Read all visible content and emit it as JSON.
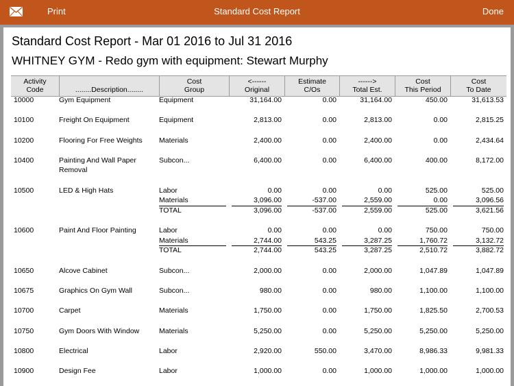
{
  "topbar": {
    "mail_icon": "mail-icon",
    "print_label": "Print",
    "title": "Standard Cost Report",
    "done_label": "Done",
    "bg_color": "#c0561b"
  },
  "report": {
    "title": "Standard Cost Report - Mar 01 2016 to Jul 31 2016",
    "subtitle": "WHITNEY GYM - Redo gym with equipment: Stewart Murphy"
  },
  "columns": [
    {
      "l1": "Activity",
      "l2": "Code"
    },
    {
      "l1": "",
      "l2": "........Description........"
    },
    {
      "l1": "Cost",
      "l2": "Group"
    },
    {
      "l1": "<------",
      "l2": "Original"
    },
    {
      "l1": "Estimate",
      "l2": "C/Os"
    },
    {
      "l1": "------>",
      "l2": "Total Est."
    },
    {
      "l1": "Cost",
      "l2": "This Period"
    },
    {
      "l1": "Cost",
      "l2": "To Date"
    }
  ],
  "rows": [
    {
      "code": "10000",
      "desc": "Gym Equipment",
      "lines": [
        {
          "group": "Equipment",
          "orig": "31,164.00",
          "cos": "0.00",
          "total": "31,164.00",
          "period": "450.00",
          "todate": "31,613.53"
        }
      ]
    },
    {
      "code": "10100",
      "desc": "Freight On Equipment",
      "lines": [
        {
          "group": "Equipment",
          "orig": "2,813.00",
          "cos": "0.00",
          "total": "2,813.00",
          "period": "0.00",
          "todate": "2,815.25"
        }
      ]
    },
    {
      "code": "10200",
      "desc": "Flooring For Free Weights",
      "lines": [
        {
          "group": "Materials",
          "orig": "2,400.00",
          "cos": "0.00",
          "total": "2,400.00",
          "period": "0.00",
          "todate": "2,434.64"
        }
      ]
    },
    {
      "code": "10400",
      "desc": "Painting And Wall Paper",
      "desc2": "Removal",
      "lines": [
        {
          "group": "Subcon...",
          "orig": "6,400.00",
          "cos": "0.00",
          "total": "6,400.00",
          "period": "400.00",
          "todate": "8,172.00"
        }
      ]
    },
    {
      "code": "10500",
      "desc": "LED & High Hats",
      "lines": [
        {
          "group": "Labor",
          "orig": "0.00",
          "cos": "0.00",
          "total": "0.00",
          "period": "525.00",
          "todate": "525.00"
        },
        {
          "group": "Materials",
          "orig": "3,096.00",
          "cos": "-537.00",
          "total": "2,559.00",
          "period": "0.00",
          "todate": "3,096.56"
        },
        {
          "group": "TOTAL",
          "orig": "3,096.00",
          "cos": "-537.00",
          "total": "2,559.00",
          "period": "525.00",
          "todate": "3,621.56",
          "is_total": true
        }
      ]
    },
    {
      "code": "10600",
      "desc": "Paint And Floor Painting",
      "lines": [
        {
          "group": "Labor",
          "orig": "0.00",
          "cos": "0.00",
          "total": "0.00",
          "period": "750.00",
          "todate": "750.00"
        },
        {
          "group": "Materials",
          "orig": "2,744.00",
          "cos": "543.25",
          "total": "3,287.25",
          "period": "1,760.72",
          "todate": "3,132.72"
        },
        {
          "group": "TOTAL",
          "orig": "2,744.00",
          "cos": "543.25",
          "total": "3,287.25",
          "period": "2,510.72",
          "todate": "3,882.72",
          "is_total": true
        }
      ]
    },
    {
      "code": "10650",
      "desc": "Alcove Cabinet",
      "lines": [
        {
          "group": "Subcon...",
          "orig": "2,000.00",
          "cos": "0.00",
          "total": "2,000.00",
          "period": "1,047.89",
          "todate": "1,047.89"
        }
      ]
    },
    {
      "code": "10675",
      "desc": "Graphics On Gym Wall",
      "lines": [
        {
          "group": "Subcon...",
          "orig": "980.00",
          "cos": "0.00",
          "total": "980.00",
          "period": "1,100.00",
          "todate": "1,100.00"
        }
      ]
    },
    {
      "code": "10700",
      "desc": "Carpet",
      "lines": [
        {
          "group": "Materials",
          "orig": "1,750.00",
          "cos": "0.00",
          "total": "1,750.00",
          "period": "1,825.50",
          "todate": "2,700.53"
        }
      ]
    },
    {
      "code": "10750",
      "desc": "Gym Doors With Window",
      "lines": [
        {
          "group": "Materials",
          "orig": "5,250.00",
          "cos": "0.00",
          "total": "5,250.00",
          "period": "5,250.00",
          "todate": "5,250.00"
        }
      ]
    },
    {
      "code": "10800",
      "desc": "Electrical",
      "lines": [
        {
          "group": "Labor",
          "orig": "2,920.00",
          "cos": "550.00",
          "total": "3,470.00",
          "period": "8,986.33",
          "todate": "9,981.33"
        }
      ]
    },
    {
      "code": "10900",
      "desc": "Design Fee",
      "lines": [
        {
          "group": "Labor",
          "orig": "1,000.00",
          "cos": "0.00",
          "total": "1,000.00",
          "period": "1,000.00",
          "todate": "1,000.00"
        }
      ]
    }
  ]
}
